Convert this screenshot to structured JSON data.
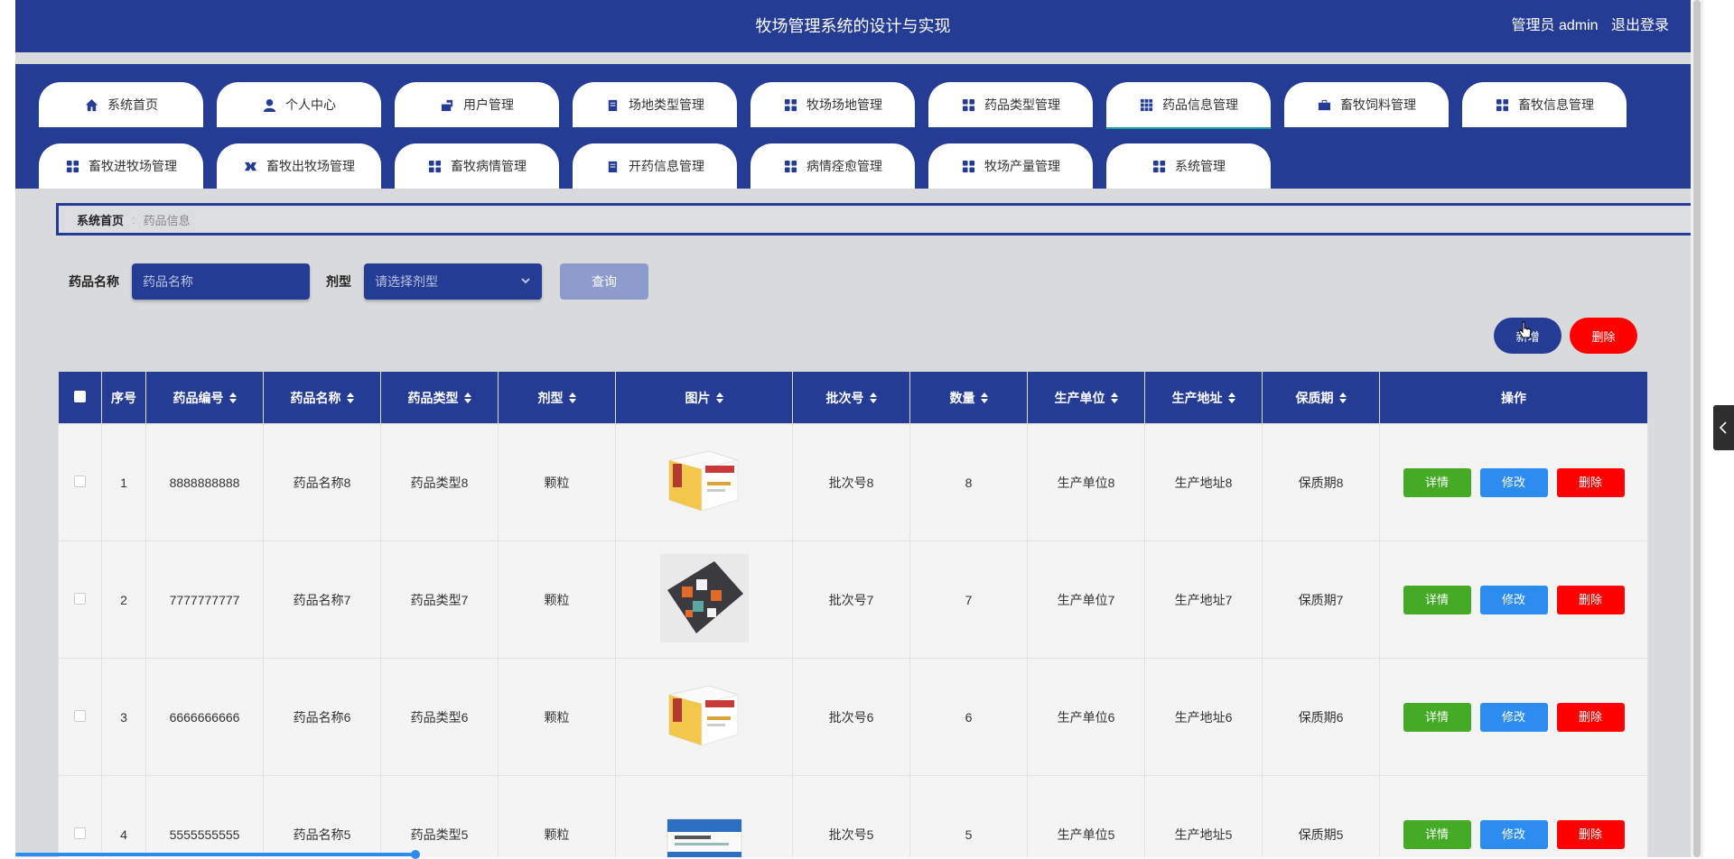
{
  "header": {
    "title": "牧场管理系统的设计与实现",
    "user_label": "管理员 admin",
    "logout_label": "退出登录"
  },
  "nav": {
    "row1": [
      {
        "label": "系统首页",
        "icon": "home-icon"
      },
      {
        "label": "个人中心",
        "icon": "user-icon"
      },
      {
        "label": "用户管理",
        "icon": "user-manage-icon"
      },
      {
        "label": "场地类型管理",
        "icon": "clipboard-icon"
      },
      {
        "label": "牧场场地管理",
        "icon": "grid-icon"
      },
      {
        "label": "药品类型管理",
        "icon": "grid-icon"
      },
      {
        "label": "药品信息管理",
        "icon": "apps-icon"
      },
      {
        "label": "畜牧饲料管理",
        "icon": "briefcase-icon"
      },
      {
        "label": "畜牧信息管理",
        "icon": "grid-icon"
      }
    ],
    "row2": [
      {
        "label": "畜牧进牧场管理",
        "icon": "grid-icon"
      },
      {
        "label": "畜牧出牧场管理",
        "icon": "exchange-icon"
      },
      {
        "label": "畜牧病情管理",
        "icon": "grid-icon"
      },
      {
        "label": "开药信息管理",
        "icon": "clipboard-icon"
      },
      {
        "label": "病情痊愈管理",
        "icon": "grid-icon"
      },
      {
        "label": "牧场产量管理",
        "icon": "grid-icon"
      },
      {
        "label": "系统管理",
        "icon": "grid-icon"
      }
    ],
    "active": "药品信息管理"
  },
  "breadcrumb": {
    "home": "系统首页",
    "current": "药品信息"
  },
  "search": {
    "name_label": "药品名称",
    "name_placeholder": "药品名称",
    "type_label": "剂型",
    "type_placeholder": "请选择剂型",
    "query_label": "查询"
  },
  "actions": {
    "add_label": "新增",
    "delete_label": "删除"
  },
  "table": {
    "columns": [
      "序号",
      "药品编号",
      "药品名称",
      "药品类型",
      "剂型",
      "图片",
      "批次号",
      "数量",
      "生产单位",
      "生产地址",
      "保质期",
      "操作"
    ],
    "rows": [
      {
        "index": "1",
        "code": "8888888888",
        "name": "药品名称8",
        "type": "药品类型8",
        "form": "颗粒",
        "image": "medicine-box",
        "batch": "批次号8",
        "qty": "8",
        "unit": "生产单位8",
        "addr": "生产地址8",
        "shelf": "保质期8"
      },
      {
        "index": "2",
        "code": "7777777777",
        "name": "药品名称7",
        "type": "药品类型7",
        "form": "颗粒",
        "image": "pill-organizer",
        "batch": "批次号7",
        "qty": "7",
        "unit": "生产单位7",
        "addr": "生产地址7",
        "shelf": "保质期7"
      },
      {
        "index": "3",
        "code": "6666666666",
        "name": "药品名称6",
        "type": "药品类型6",
        "form": "颗粒",
        "image": "medicine-box",
        "batch": "批次号6",
        "qty": "6",
        "unit": "生产单位6",
        "addr": "生产地址6",
        "shelf": "保质期6"
      },
      {
        "index": "4",
        "code": "5555555555",
        "name": "药品名称5",
        "type": "药品类型5",
        "form": "颗粒",
        "image": "blue-medicine-box",
        "batch": "批次号5",
        "qty": "5",
        "unit": "生产单位5",
        "addr": "生产地址5",
        "shelf": "保质期5"
      }
    ],
    "op_detail": "详情",
    "op_edit": "修改",
    "op_delete": "删除"
  },
  "colors": {
    "primary": "#253c95",
    "detail": "#45ab26",
    "edit": "#2d8cf0",
    "danger": "#ff0000"
  }
}
